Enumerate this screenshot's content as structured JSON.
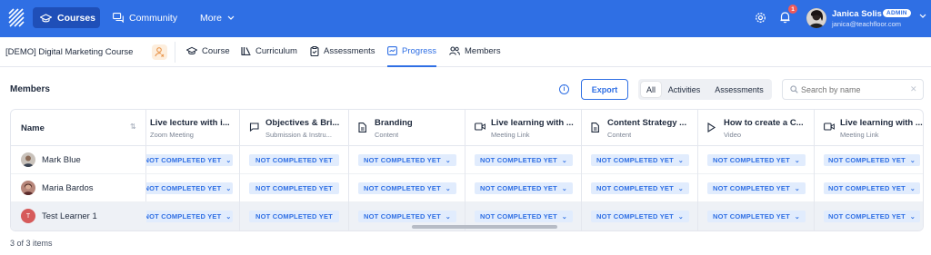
{
  "topnav": {
    "courses_label": "Courses",
    "community_label": "Community",
    "more_label": "More",
    "notification_count": "1",
    "user_name": "Janica Solis",
    "user_badge": "ADMIN",
    "user_email": "janica@teachfloor.com",
    "accent_color": "#2f6fe4"
  },
  "coursebar": {
    "course_title": "[DEMO] Digital Marketing Course",
    "tabs": [
      {
        "label": "Course",
        "icon": "graduation-cap-icon"
      },
      {
        "label": "Curriculum",
        "icon": "library-icon"
      },
      {
        "label": "Assessments",
        "icon": "clipboard-icon"
      },
      {
        "label": "Progress",
        "icon": "progress-icon",
        "active": true
      },
      {
        "label": "Members",
        "icon": "users-icon"
      }
    ]
  },
  "members": {
    "title": "Members",
    "export_label": "Export",
    "filters": [
      "All",
      "Activities",
      "Assessments"
    ],
    "active_filter": "All",
    "search_placeholder": "Search by name",
    "items_count": "3 of 3 items"
  },
  "table": {
    "name_header": "Name",
    "columns": [
      {
        "title": "Live lecture with i...",
        "subtitle": "Zoom Meeting",
        "icon": "none"
      },
      {
        "title": "Objectives & Bri...",
        "subtitle": "Submission & Instru...",
        "icon": "comment-icon"
      },
      {
        "title": "Branding",
        "subtitle": "Content",
        "icon": "document-icon"
      },
      {
        "title": "Live learning with ...",
        "subtitle": "Meeting Link",
        "icon": "video-icon"
      },
      {
        "title": "Content Strategy ...",
        "subtitle": "Content",
        "icon": "document-icon"
      },
      {
        "title": "How to create a C...",
        "subtitle": "Video",
        "icon": "play-icon"
      },
      {
        "title": "Live learning with ...",
        "subtitle": "Meeting Link",
        "icon": "video-icon"
      }
    ],
    "rows": [
      {
        "name": "Mark Blue",
        "avatar": "photo"
      },
      {
        "name": "Maria Bardos",
        "avatar": "photo"
      },
      {
        "name": "Test Learner 1",
        "avatar": "T"
      }
    ],
    "status_label": "NOT COMPLETED YET"
  }
}
